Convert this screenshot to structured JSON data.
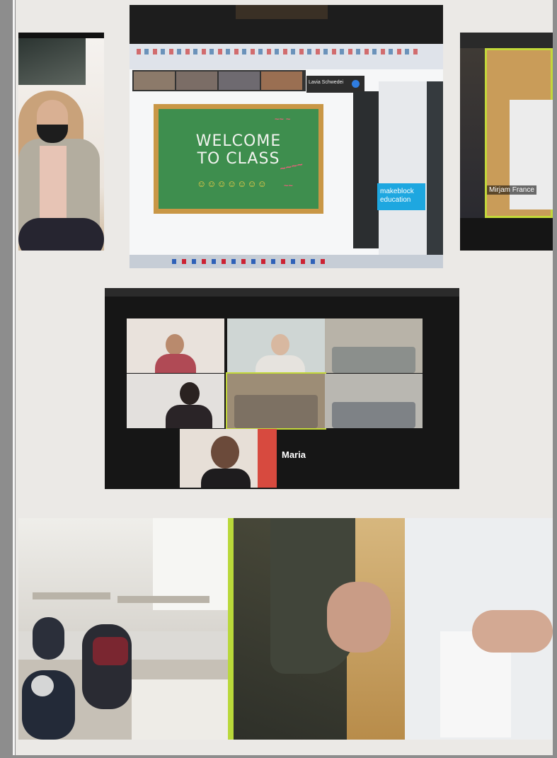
{
  "collage": {
    "photo_teacher": {
      "caption": ""
    },
    "photo_welcome_screen": {
      "board_line1": "WELCOME",
      "board_line2": "TO CLASS",
      "participant_name": "Lavia Schwedei",
      "sponsor_badge_line1": "makeblock",
      "sponsor_badge_line2": "education"
    },
    "photo_hands_right": {
      "participant_label": "Mirjam France"
    },
    "photo_zoom_grid": {
      "featured_participant": "Maria"
    },
    "photo_classroom": {
      "caption": ""
    },
    "photo_paper_pointing": {
      "caption": ""
    }
  },
  "colors": {
    "page_background": "#ebe9e6",
    "page_border": "#8d8d8d",
    "chalkboard_green": "#3e8e4e",
    "chalkboard_frame": "#c99746",
    "active_speaker_border": "#c3d83a"
  }
}
